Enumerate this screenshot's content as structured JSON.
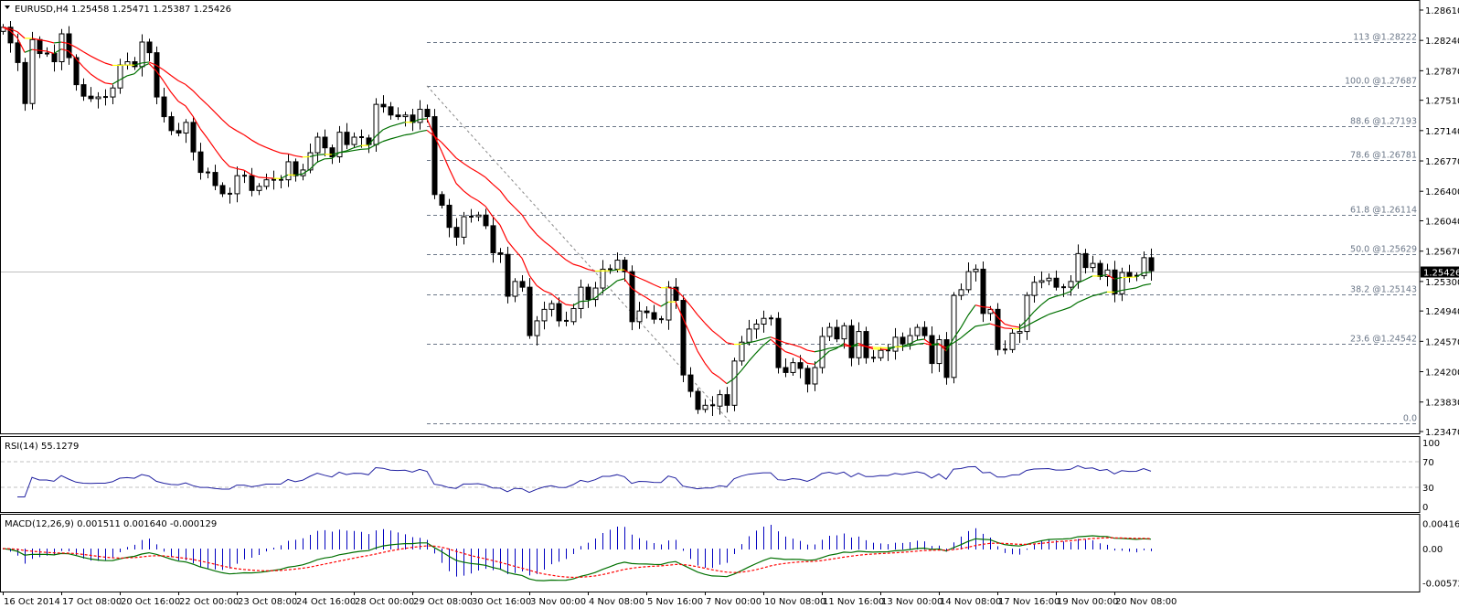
{
  "header": {
    "symbol": "EURUSD,H4",
    "ohlc_text": "1.25458 1.25471 1.25387 1.25426"
  },
  "colors": {
    "bull_body": "#ffffff",
    "bear_body": "#000000",
    "ma_up": "#007000",
    "ma_down": "#ff0000",
    "ma_flat": "#ffff00",
    "fib": "#6b7788",
    "rsi": "#2020a0",
    "macd_hist": "#0000c0",
    "macd_main": "#007000",
    "macd_signal": "#ff0000",
    "current_line": "#c0c0c0"
  },
  "current_price": "1.25426",
  "price_axis": [
    "1.28610",
    "1.28240",
    "1.27870",
    "1.27510",
    "1.27140",
    "1.26770",
    "1.26400",
    "1.26040",
    "1.25670",
    "1.25300",
    "1.24940",
    "1.24570",
    "1.24200",
    "1.23830",
    "1.23470"
  ],
  "fib_levels": [
    {
      "level": "113",
      "price_text": "@1.28222",
      "price": 1.28222
    },
    {
      "level": "100.0",
      "price_text": "@1.27687",
      "price": 1.27687
    },
    {
      "level": "88.6",
      "price_text": "@1.27193",
      "price": 1.27193
    },
    {
      "level": "78.6",
      "price_text": "@1.26781",
      "price": 1.26781
    },
    {
      "level": "61.8",
      "price_text": "@1.26114",
      "price": 1.26114
    },
    {
      "level": "50.0",
      "price_text": "@1.25629",
      "price": 1.25629
    },
    {
      "level": "38.2",
      "price_text": "@1.25143",
      "price": 1.25143
    },
    {
      "level": "23.6",
      "price_text": "@1.24542",
      "price": 1.24542
    },
    {
      "level": "0.0",
      "price_text": "",
      "price": 1.23571
    }
  ],
  "rsi": {
    "label": "RSI(14) 55.1279",
    "axis": [
      "100",
      "70",
      "30",
      "0"
    ]
  },
  "macd": {
    "label": "MACD(12,26,9) 0.001511 0.001640 -0.000129",
    "axis": [
      "0.004168",
      "0.00",
      "-0.005721"
    ]
  },
  "time_axis": [
    "16 Oct 2014",
    "17 Oct 08:00",
    "20 Oct 16:00",
    "22 Oct 00:00",
    "23 Oct 08:00",
    "24 Oct 16:00",
    "28 Oct 00:00",
    "29 Oct 08:00",
    "30 Oct 16:00",
    "3 Nov 00:00",
    "4 Nov 08:00",
    "5 Nov 16:00",
    "7 Nov 00:00",
    "10 Nov 08:00",
    "11 Nov 16:00",
    "13 Nov 00:00",
    "14 Nov 08:00",
    "17 Nov 16:00",
    "19 Nov 00:00",
    "20 Nov 08:00"
  ],
  "chart_data": {
    "type": "candlestick",
    "title": "EURUSD,H4",
    "ylim": [
      1.2347,
      1.2861
    ],
    "bars_per_time_label": 8,
    "first_open": 1.2835,
    "close": [
      1.284,
      1.2821,
      1.2797,
      1.2747,
      1.2825,
      1.2808,
      1.2808,
      1.2798,
      1.2832,
      1.2803,
      1.277,
      1.2756,
      1.2753,
      1.2755,
      1.2755,
      1.2766,
      1.2794,
      1.2798,
      1.2792,
      1.2822,
      1.2809,
      1.2755,
      1.2731,
      1.2714,
      1.2711,
      1.2724,
      1.2688,
      1.2663,
      1.2663,
      1.2647,
      1.2637,
      1.2637,
      1.2659,
      1.2659,
      1.2641,
      1.2646,
      1.2654,
      1.2654,
      1.2654,
      1.2676,
      1.2659,
      1.2666,
      1.2687,
      1.2706,
      1.2693,
      1.2682,
      1.2712,
      1.2697,
      1.2706,
      1.2705,
      1.2697,
      1.2746,
      1.2743,
      1.2733,
      1.2731,
      1.2733,
      1.2724,
      1.274,
      1.2731,
      1.2636,
      1.2623,
      1.2596,
      1.2584,
      1.2609,
      1.2609,
      1.2611,
      1.2598,
      1.2565,
      1.2563,
      1.2512,
      1.253,
      1.2523,
      1.2464,
      1.2482,
      1.2496,
      1.2503,
      1.2482,
      1.2481,
      1.2497,
      1.2523,
      1.2508,
      1.2522,
      1.2545,
      1.2545,
      1.2556,
      1.2542,
      1.2481,
      1.2494,
      1.2492,
      1.2484,
      1.2483,
      1.2523,
      1.2507,
      1.2416,
      1.2396,
      1.2374,
      1.2379,
      1.2378,
      1.2392,
      1.2379,
      1.2433,
      1.2456,
      1.2472,
      1.2478,
      1.2485,
      1.2485,
      1.2425,
      1.2419,
      1.2431,
      1.2424,
      1.2405,
      1.2425,
      1.2463,
      1.2474,
      1.246,
      1.2476,
      1.2437,
      1.2469,
      1.2437,
      1.2437,
      1.2446,
      1.2445,
      1.2462,
      1.2454,
      1.2464,
      1.2474,
      1.2464,
      1.243,
      1.2459,
      1.2413,
      1.2513,
      1.252,
      1.2542,
      1.2545,
      1.2491,
      1.2496,
      1.2447,
      1.2447,
      1.2467,
      1.2469,
      1.2513,
      1.2529,
      1.2531,
      1.2534,
      1.2523,
      1.2523,
      1.253,
      1.2564,
      1.2547,
      1.2552,
      1.2536,
      1.2544,
      1.2515,
      1.2541,
      1.2536,
      1.2537,
      1.2559,
      1.2543
    ],
    "indicators": [
      "MA fast",
      "MA slow",
      "RSI(14)",
      "MACD(12,26,9)"
    ]
  }
}
